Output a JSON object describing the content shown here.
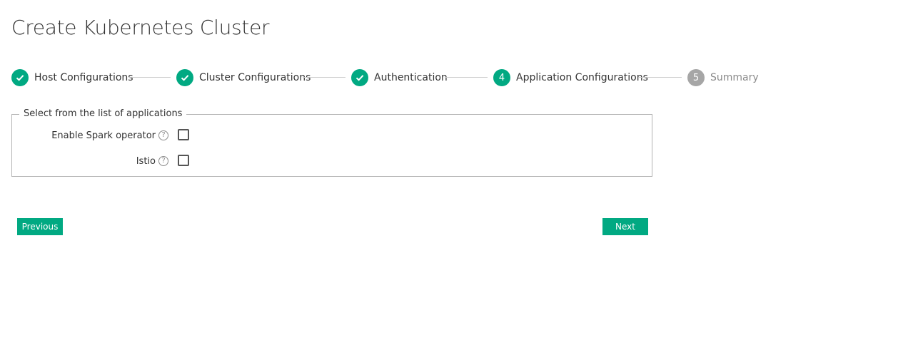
{
  "page": {
    "title": "Create Kubernetes Cluster"
  },
  "stepper": {
    "steps": [
      {
        "number": "1",
        "label": "Host Configurations",
        "state": "completed"
      },
      {
        "number": "2",
        "label": "Cluster Configurations",
        "state": "completed"
      },
      {
        "number": "3",
        "label": "Authentication",
        "state": "completed"
      },
      {
        "number": "4",
        "label": "Application Configurations",
        "state": "active"
      },
      {
        "number": "5",
        "label": "Summary",
        "state": "pending"
      }
    ]
  },
  "applications": {
    "legend": "Select from the list of applications",
    "options": [
      {
        "label": "Enable Spark operator",
        "help_icon": "?",
        "checked": false
      },
      {
        "label": "Istio",
        "help_icon": "?",
        "checked": false
      }
    ]
  },
  "actions": {
    "previous_label": "Previous",
    "next_label": "Next"
  },
  "colors": {
    "accent": "#01a982",
    "pending": "#a6a6a6"
  },
  "icons": {
    "completed_step": "checkmark-icon",
    "help": "question-circle-icon"
  }
}
